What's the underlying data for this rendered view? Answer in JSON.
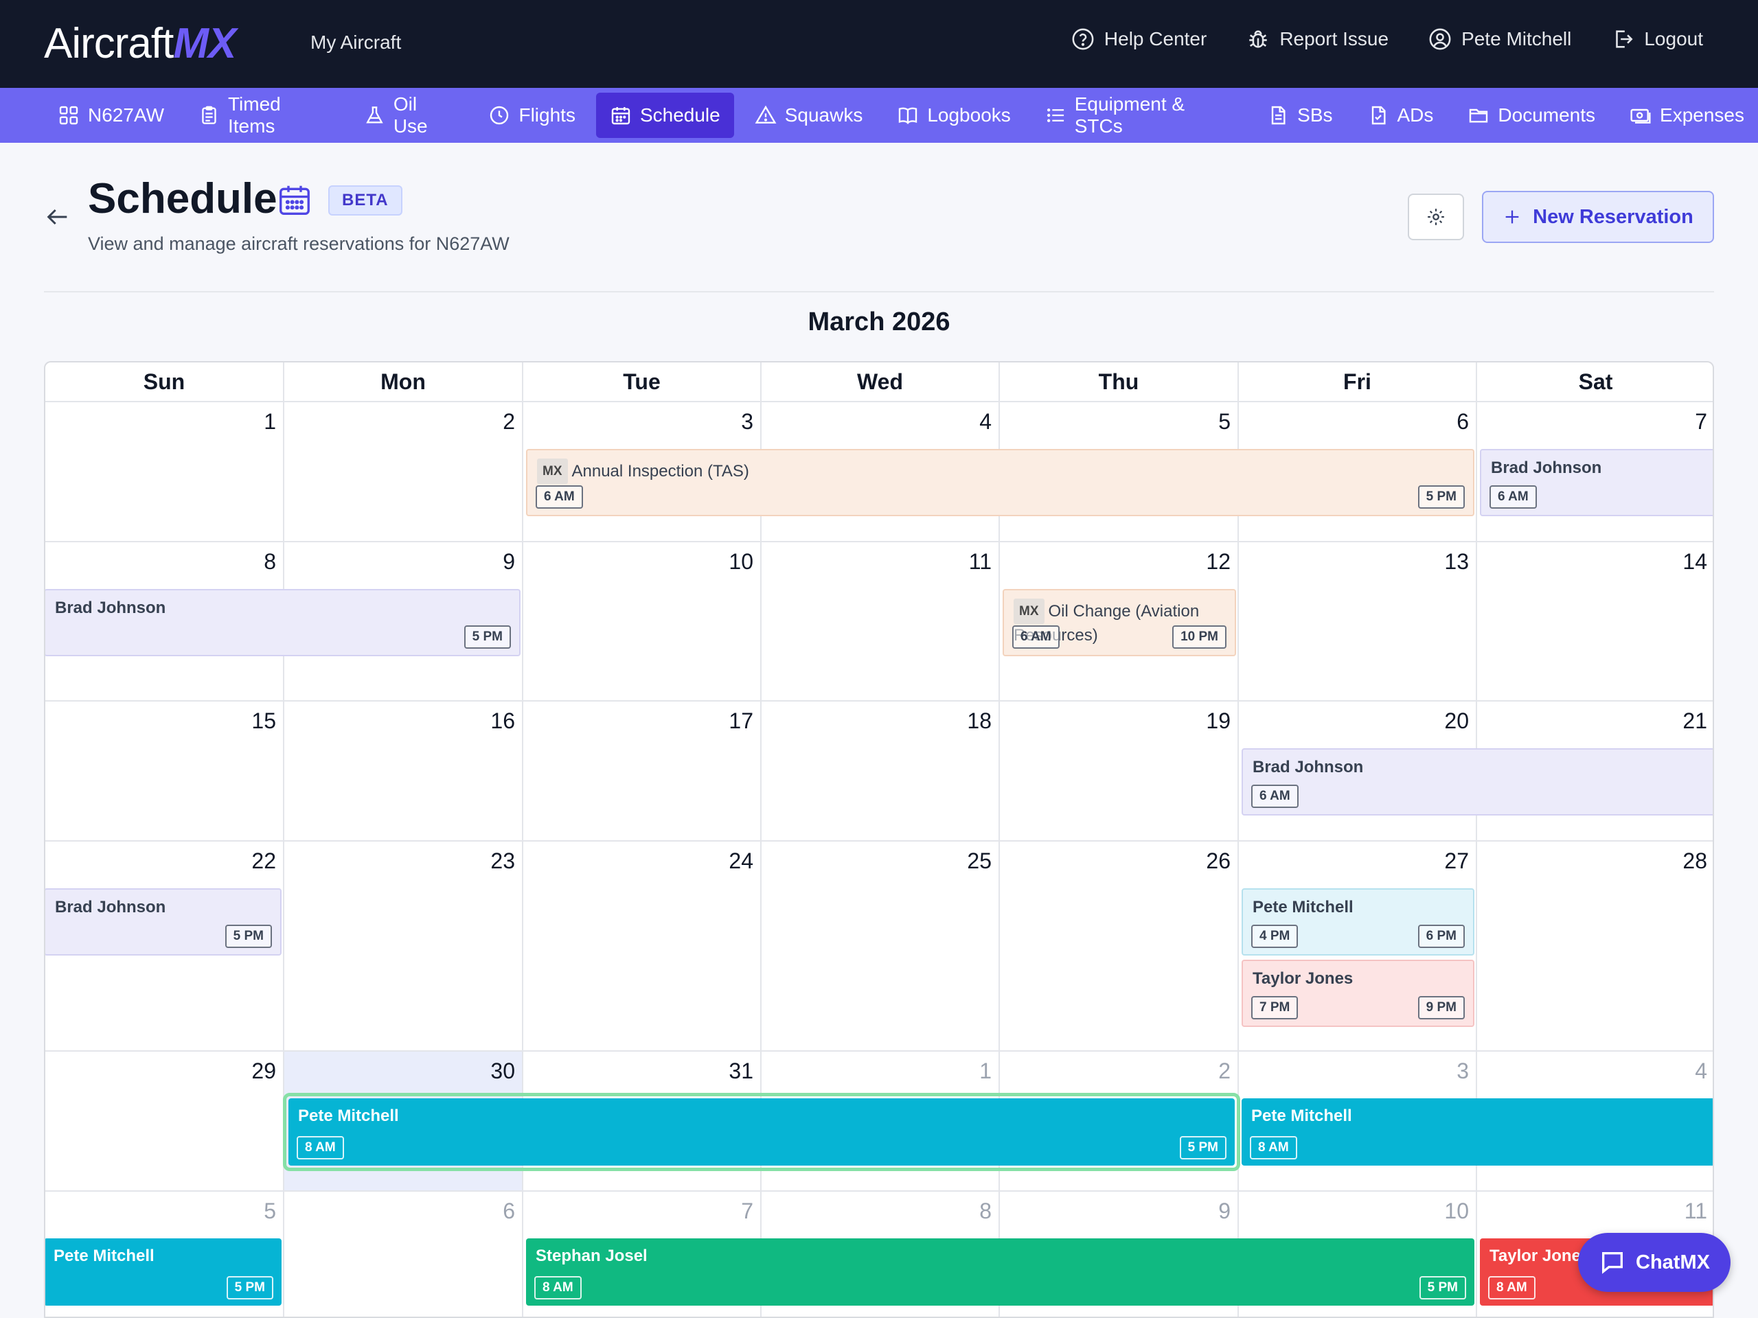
{
  "topbar": {
    "logo_main": "Aircraft",
    "logo_accent": "MX",
    "my_aircraft": "My Aircraft",
    "links": [
      {
        "label": "Help Center",
        "icon": "help-circle-icon"
      },
      {
        "label": "Report Issue",
        "icon": "bug-icon"
      },
      {
        "label": "Pete Mitchell",
        "icon": "user-circle-icon"
      },
      {
        "label": "Logout",
        "icon": "logout-icon"
      }
    ]
  },
  "nav": {
    "items": [
      {
        "label": "N627AW",
        "icon": "grid-icon"
      },
      {
        "label": "Timed Items",
        "icon": "clipboard-icon"
      },
      {
        "label": "Oil Use",
        "icon": "flask-icon"
      },
      {
        "label": "Flights",
        "icon": "clock-icon"
      },
      {
        "label": "Schedule",
        "icon": "calendar-icon",
        "active": true
      },
      {
        "label": "Squawks",
        "icon": "warning-icon"
      },
      {
        "label": "Logbooks",
        "icon": "book-icon"
      },
      {
        "label": "Equipment & STCs",
        "icon": "list-icon"
      },
      {
        "label": "SBs",
        "icon": "document-icon"
      },
      {
        "label": "ADs",
        "icon": "document-check-icon"
      },
      {
        "label": "Documents",
        "icon": "folder-icon"
      },
      {
        "label": "Expenses",
        "icon": "money-icon"
      }
    ]
  },
  "header": {
    "title": "Schedule",
    "badge": "BETA",
    "subtitle": "View and manage aircraft reservations for N627AW",
    "new_reservation": "New Reservation"
  },
  "calendar": {
    "month_title": "March 2026",
    "weekdays": [
      "Sun",
      "Mon",
      "Tue",
      "Wed",
      "Thu",
      "Fri",
      "Sat"
    ],
    "weeks": [
      [
        "1",
        "2",
        "3",
        "4",
        "5",
        "6",
        "7"
      ],
      [
        "8",
        "9",
        "10",
        "11",
        "12",
        "13",
        "14"
      ],
      [
        "15",
        "16",
        "17",
        "18",
        "19",
        "20",
        "21"
      ],
      [
        "22",
        "23",
        "24",
        "25",
        "26",
        "27",
        "28"
      ],
      [
        "29",
        "30",
        "31",
        "1",
        "2",
        "3",
        "4"
      ],
      [
        "5",
        "6",
        "7",
        "8",
        "9",
        "10",
        "11"
      ]
    ],
    "today": "30",
    "events": [
      {
        "label": "Annual Inspection (TAS)",
        "tag": "MX",
        "start": "6 AM",
        "end": "5 PM"
      },
      {
        "label": "Brad Johnson",
        "start": "6 AM",
        "end": ""
      },
      {
        "label": "Brad Johnson",
        "start": "",
        "end": "5 PM"
      },
      {
        "label": "Oil Change (Aviation Resources)",
        "tag": "MX",
        "start": "6 AM",
        "end": "10 PM"
      },
      {
        "label": "Brad Johnson",
        "start": "6 AM",
        "end": ""
      },
      {
        "label": "Brad Johnson",
        "start": "",
        "end": "5 PM"
      },
      {
        "label": "Pete Mitchell",
        "start": "4 PM",
        "end": "6 PM"
      },
      {
        "label": "Taylor Jones",
        "start": "7 PM",
        "end": "9 PM"
      },
      {
        "label": "Pete Mitchell",
        "start": "8 AM",
        "end": "5 PM"
      },
      {
        "label": "Pete Mitchell",
        "start": "8 AM",
        "end": ""
      },
      {
        "label": "Pete Mitchell",
        "start": "",
        "end": "5 PM"
      },
      {
        "label": "Stephan Josel",
        "start": "8 AM",
        "end": "5 PM"
      },
      {
        "label": "Taylor Jones",
        "start": "8 AM",
        "end": ""
      }
    ]
  },
  "chat": {
    "label": "ChatMX"
  },
  "colors": {
    "topbar": "#121829",
    "navbar": "#6d66f2",
    "nav_active": "#4930d6",
    "mx_event": "#fbede3",
    "brad_event": "#ecebfa",
    "pete_event": "#06b4d4",
    "stephan_event": "#10b981",
    "taylor_event": "#ef4444"
  }
}
